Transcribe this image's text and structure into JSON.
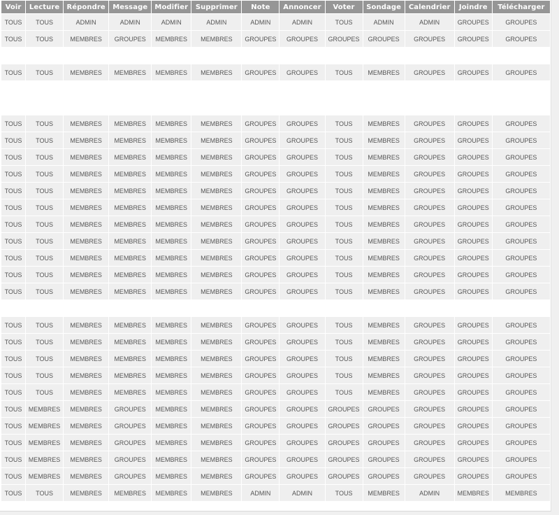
{
  "table": {
    "headers": [
      "Voir",
      "Lecture",
      "Répondre",
      "Message",
      "Modifier",
      "Supprimer",
      "Note",
      "Annoncer",
      "Voter",
      "Sondage",
      "Calendrier",
      "Joindre",
      "Télécharger"
    ],
    "sections": [
      {
        "rows": [
          [
            "TOUS",
            "TOUS",
            "ADMIN",
            "ADMIN",
            "ADMIN",
            "ADMIN",
            "ADMIN",
            "ADMIN",
            "TOUS",
            "ADMIN",
            "ADMIN",
            "GROUPES",
            "GROUPES"
          ],
          [
            "TOUS",
            "TOUS",
            "MEMBRES",
            "GROUPES",
            "MEMBRES",
            "MEMBRES",
            "GROUPES",
            "GROUPES",
            "GROUPES",
            "GROUPES",
            "GROUPES",
            "GROUPES",
            "GROUPES"
          ]
        ],
        "gap_after": 1
      },
      {
        "rows": [
          [
            "TOUS",
            "TOUS",
            "MEMBRES",
            "MEMBRES",
            "MEMBRES",
            "MEMBRES",
            "GROUPES",
            "GROUPES",
            "TOUS",
            "MEMBRES",
            "GROUPES",
            "GROUPES",
            "GROUPES"
          ]
        ],
        "gap_after": 2
      },
      {
        "rows": [
          [
            "TOUS",
            "TOUS",
            "MEMBRES",
            "MEMBRES",
            "MEMBRES",
            "MEMBRES",
            "GROUPES",
            "GROUPES",
            "TOUS",
            "MEMBRES",
            "GROUPES",
            "GROUPES",
            "GROUPES"
          ],
          [
            "TOUS",
            "TOUS",
            "MEMBRES",
            "MEMBRES",
            "MEMBRES",
            "MEMBRES",
            "GROUPES",
            "GROUPES",
            "TOUS",
            "MEMBRES",
            "GROUPES",
            "GROUPES",
            "GROUPES"
          ],
          [
            "TOUS",
            "TOUS",
            "MEMBRES",
            "MEMBRES",
            "MEMBRES",
            "MEMBRES",
            "GROUPES",
            "GROUPES",
            "TOUS",
            "MEMBRES",
            "GROUPES",
            "GROUPES",
            "GROUPES"
          ],
          [
            "TOUS",
            "TOUS",
            "MEMBRES",
            "MEMBRES",
            "MEMBRES",
            "MEMBRES",
            "GROUPES",
            "GROUPES",
            "TOUS",
            "MEMBRES",
            "GROUPES",
            "GROUPES",
            "GROUPES"
          ],
          [
            "TOUS",
            "TOUS",
            "MEMBRES",
            "MEMBRES",
            "MEMBRES",
            "MEMBRES",
            "GROUPES",
            "GROUPES",
            "TOUS",
            "MEMBRES",
            "GROUPES",
            "GROUPES",
            "GROUPES"
          ],
          [
            "TOUS",
            "TOUS",
            "MEMBRES",
            "MEMBRES",
            "MEMBRES",
            "MEMBRES",
            "GROUPES",
            "GROUPES",
            "TOUS",
            "MEMBRES",
            "GROUPES",
            "GROUPES",
            "GROUPES"
          ],
          [
            "TOUS",
            "TOUS",
            "MEMBRES",
            "MEMBRES",
            "MEMBRES",
            "MEMBRES",
            "GROUPES",
            "GROUPES",
            "TOUS",
            "MEMBRES",
            "GROUPES",
            "GROUPES",
            "GROUPES"
          ],
          [
            "TOUS",
            "TOUS",
            "MEMBRES",
            "MEMBRES",
            "MEMBRES",
            "MEMBRES",
            "GROUPES",
            "GROUPES",
            "TOUS",
            "MEMBRES",
            "GROUPES",
            "GROUPES",
            "GROUPES"
          ],
          [
            "TOUS",
            "TOUS",
            "MEMBRES",
            "MEMBRES",
            "MEMBRES",
            "MEMBRES",
            "GROUPES",
            "GROUPES",
            "TOUS",
            "MEMBRES",
            "GROUPES",
            "GROUPES",
            "GROUPES"
          ],
          [
            "TOUS",
            "TOUS",
            "MEMBRES",
            "MEMBRES",
            "MEMBRES",
            "MEMBRES",
            "GROUPES",
            "GROUPES",
            "TOUS",
            "MEMBRES",
            "GROUPES",
            "GROUPES",
            "GROUPES"
          ],
          [
            "TOUS",
            "TOUS",
            "MEMBRES",
            "MEMBRES",
            "MEMBRES",
            "MEMBRES",
            "GROUPES",
            "GROUPES",
            "TOUS",
            "MEMBRES",
            "GROUPES",
            "GROUPES",
            "GROUPES"
          ]
        ],
        "gap_after": 1
      },
      {
        "rows": [
          [
            "TOUS",
            "TOUS",
            "MEMBRES",
            "MEMBRES",
            "MEMBRES",
            "MEMBRES",
            "GROUPES",
            "GROUPES",
            "TOUS",
            "MEMBRES",
            "GROUPES",
            "GROUPES",
            "GROUPES"
          ],
          [
            "TOUS",
            "TOUS",
            "MEMBRES",
            "MEMBRES",
            "MEMBRES",
            "MEMBRES",
            "GROUPES",
            "GROUPES",
            "TOUS",
            "MEMBRES",
            "GROUPES",
            "GROUPES",
            "GROUPES"
          ],
          [
            "TOUS",
            "TOUS",
            "MEMBRES",
            "MEMBRES",
            "MEMBRES",
            "MEMBRES",
            "GROUPES",
            "GROUPES",
            "TOUS",
            "MEMBRES",
            "GROUPES",
            "GROUPES",
            "GROUPES"
          ],
          [
            "TOUS",
            "TOUS",
            "MEMBRES",
            "MEMBRES",
            "MEMBRES",
            "MEMBRES",
            "GROUPES",
            "GROUPES",
            "TOUS",
            "MEMBRES",
            "GROUPES",
            "GROUPES",
            "GROUPES"
          ],
          [
            "TOUS",
            "TOUS",
            "MEMBRES",
            "MEMBRES",
            "MEMBRES",
            "MEMBRES",
            "GROUPES",
            "GROUPES",
            "TOUS",
            "MEMBRES",
            "GROUPES",
            "GROUPES",
            "GROUPES"
          ],
          [
            "TOUS",
            "MEMBRES",
            "MEMBRES",
            "GROUPES",
            "MEMBRES",
            "MEMBRES",
            "GROUPES",
            "GROUPES",
            "GROUPES",
            "GROUPES",
            "GROUPES",
            "GROUPES",
            "GROUPES"
          ],
          [
            "TOUS",
            "MEMBRES",
            "MEMBRES",
            "GROUPES",
            "MEMBRES",
            "MEMBRES",
            "GROUPES",
            "GROUPES",
            "GROUPES",
            "GROUPES",
            "GROUPES",
            "GROUPES",
            "GROUPES"
          ],
          [
            "TOUS",
            "MEMBRES",
            "MEMBRES",
            "GROUPES",
            "MEMBRES",
            "MEMBRES",
            "GROUPES",
            "GROUPES",
            "GROUPES",
            "GROUPES",
            "GROUPES",
            "GROUPES",
            "GROUPES"
          ],
          [
            "TOUS",
            "MEMBRES",
            "MEMBRES",
            "GROUPES",
            "MEMBRES",
            "MEMBRES",
            "GROUPES",
            "GROUPES",
            "GROUPES",
            "GROUPES",
            "GROUPES",
            "GROUPES",
            "GROUPES"
          ],
          [
            "TOUS",
            "MEMBRES",
            "MEMBRES",
            "GROUPES",
            "MEMBRES",
            "MEMBRES",
            "GROUPES",
            "GROUPES",
            "GROUPES",
            "GROUPES",
            "GROUPES",
            "GROUPES",
            "GROUPES"
          ],
          [
            "TOUS",
            "TOUS",
            "MEMBRES",
            "MEMBRES",
            "MEMBRES",
            "MEMBRES",
            "ADMIN",
            "ADMIN",
            "TOUS",
            "MEMBRES",
            "ADMIN",
            "MEMBRES",
            "MEMBRES"
          ]
        ],
        "gap_after": 0
      }
    ]
  },
  "colors": {
    "header_bg": "#969696",
    "header_text": "#ffffff",
    "cell_bg": "#efefef",
    "cell_text": "#555555"
  }
}
